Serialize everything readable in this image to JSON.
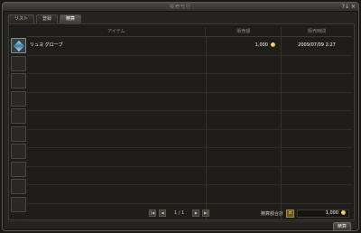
{
  "window": {
    "title": "販売代行",
    "help_glyph": "?↓",
    "close_glyph": "×"
  },
  "tabs": [
    {
      "label": "リスト",
      "active": false
    },
    {
      "label": "登録",
      "active": false
    },
    {
      "label": "精算",
      "active": true
    }
  ],
  "table": {
    "headers": {
      "item": "アイテム",
      "price": "販売額",
      "date": "販売時間"
    },
    "rows": [
      {
        "item": "リュヨ グロ一ブ",
        "price": "1,000",
        "date": "2009/07/09  2:27"
      }
    ]
  },
  "pager": {
    "first": "|◀",
    "prev": "◀",
    "page": "1 / 1",
    "next": "▶",
    "last": "▶|"
  },
  "summary": {
    "label": "精算額合計",
    "amount": "1,000"
  },
  "settle_button": "精算",
  "colors": {
    "accent_coin": "#e3b53a",
    "panel_bg": "#1f1d1a"
  }
}
